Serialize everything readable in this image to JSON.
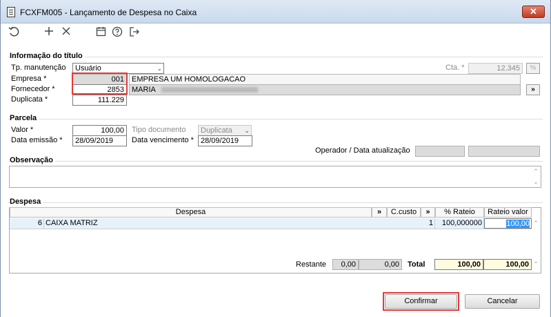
{
  "window": {
    "title": "FCXFM005 - Lançamento de Despesa no Caixa",
    "close_label": "✕"
  },
  "toolbar": {
    "icons": [
      "undo-icon",
      "add-icon",
      "delete-icon",
      "calendar-icon",
      "help-icon",
      "exit-icon"
    ]
  },
  "titulo": {
    "section_title": "Informação do título",
    "tp_manutencao_label": "Tp. manutenção",
    "tp_manutencao_value": "Usuário",
    "cta_label": "Cta. *",
    "cta_value": "12.345",
    "cta_button": "%",
    "empresa_label": "Empresa *",
    "empresa_code": "001",
    "empresa_name": "EMPRESA UM HOMOLOGACAO",
    "fornecedor_label": "Fornecedor *",
    "fornecedor_code": "2853",
    "fornecedor_name": "MARIA",
    "fornecedor_button": "»",
    "duplicata_label": "Duplicata *",
    "duplicata_value": "111.229"
  },
  "parcela": {
    "section_title": "Parcela",
    "valor_label": "Valor *",
    "valor_value": "100,00",
    "tipo_doc_label": "Tipo documento",
    "tipo_doc_value": "Duplicata",
    "data_emissao_label": "Data emissão *",
    "data_emissao_value": "28/09/2019",
    "data_venc_label": "Data vencimento *",
    "data_venc_value": "28/09/2019",
    "operador_label": "Operador / Data atualização",
    "operador_value": "",
    "data_atualizacao_value": ""
  },
  "observacao": {
    "section_title": "Observação",
    "text": ""
  },
  "despesa": {
    "section_title": "Despesa",
    "columns": {
      "despesa": "Despesa",
      "expand1": "»",
      "ccusto": "C.custo",
      "expand2": "»",
      "rateio_pct": "% Rateio",
      "rateio_valor": "Rateio valor"
    },
    "rows": [
      {
        "code": "6",
        "name": "CAIXA MATRIZ",
        "ccusto": "1",
        "rateio_pct": "100,000000",
        "rateio_valor": "100,00"
      }
    ],
    "restante_label": "Restante",
    "restante_value1": "0,00",
    "restante_value2": "0,00",
    "total_label": "Total",
    "total_pct": "100,00",
    "total_valor": "100,00"
  },
  "buttons": {
    "confirmar": "Confirmar",
    "cancelar": "Cancelar"
  },
  "colors": {
    "highlight": "#e53935",
    "selection": "#3399ff",
    "total_bg": "#fffbe0"
  }
}
